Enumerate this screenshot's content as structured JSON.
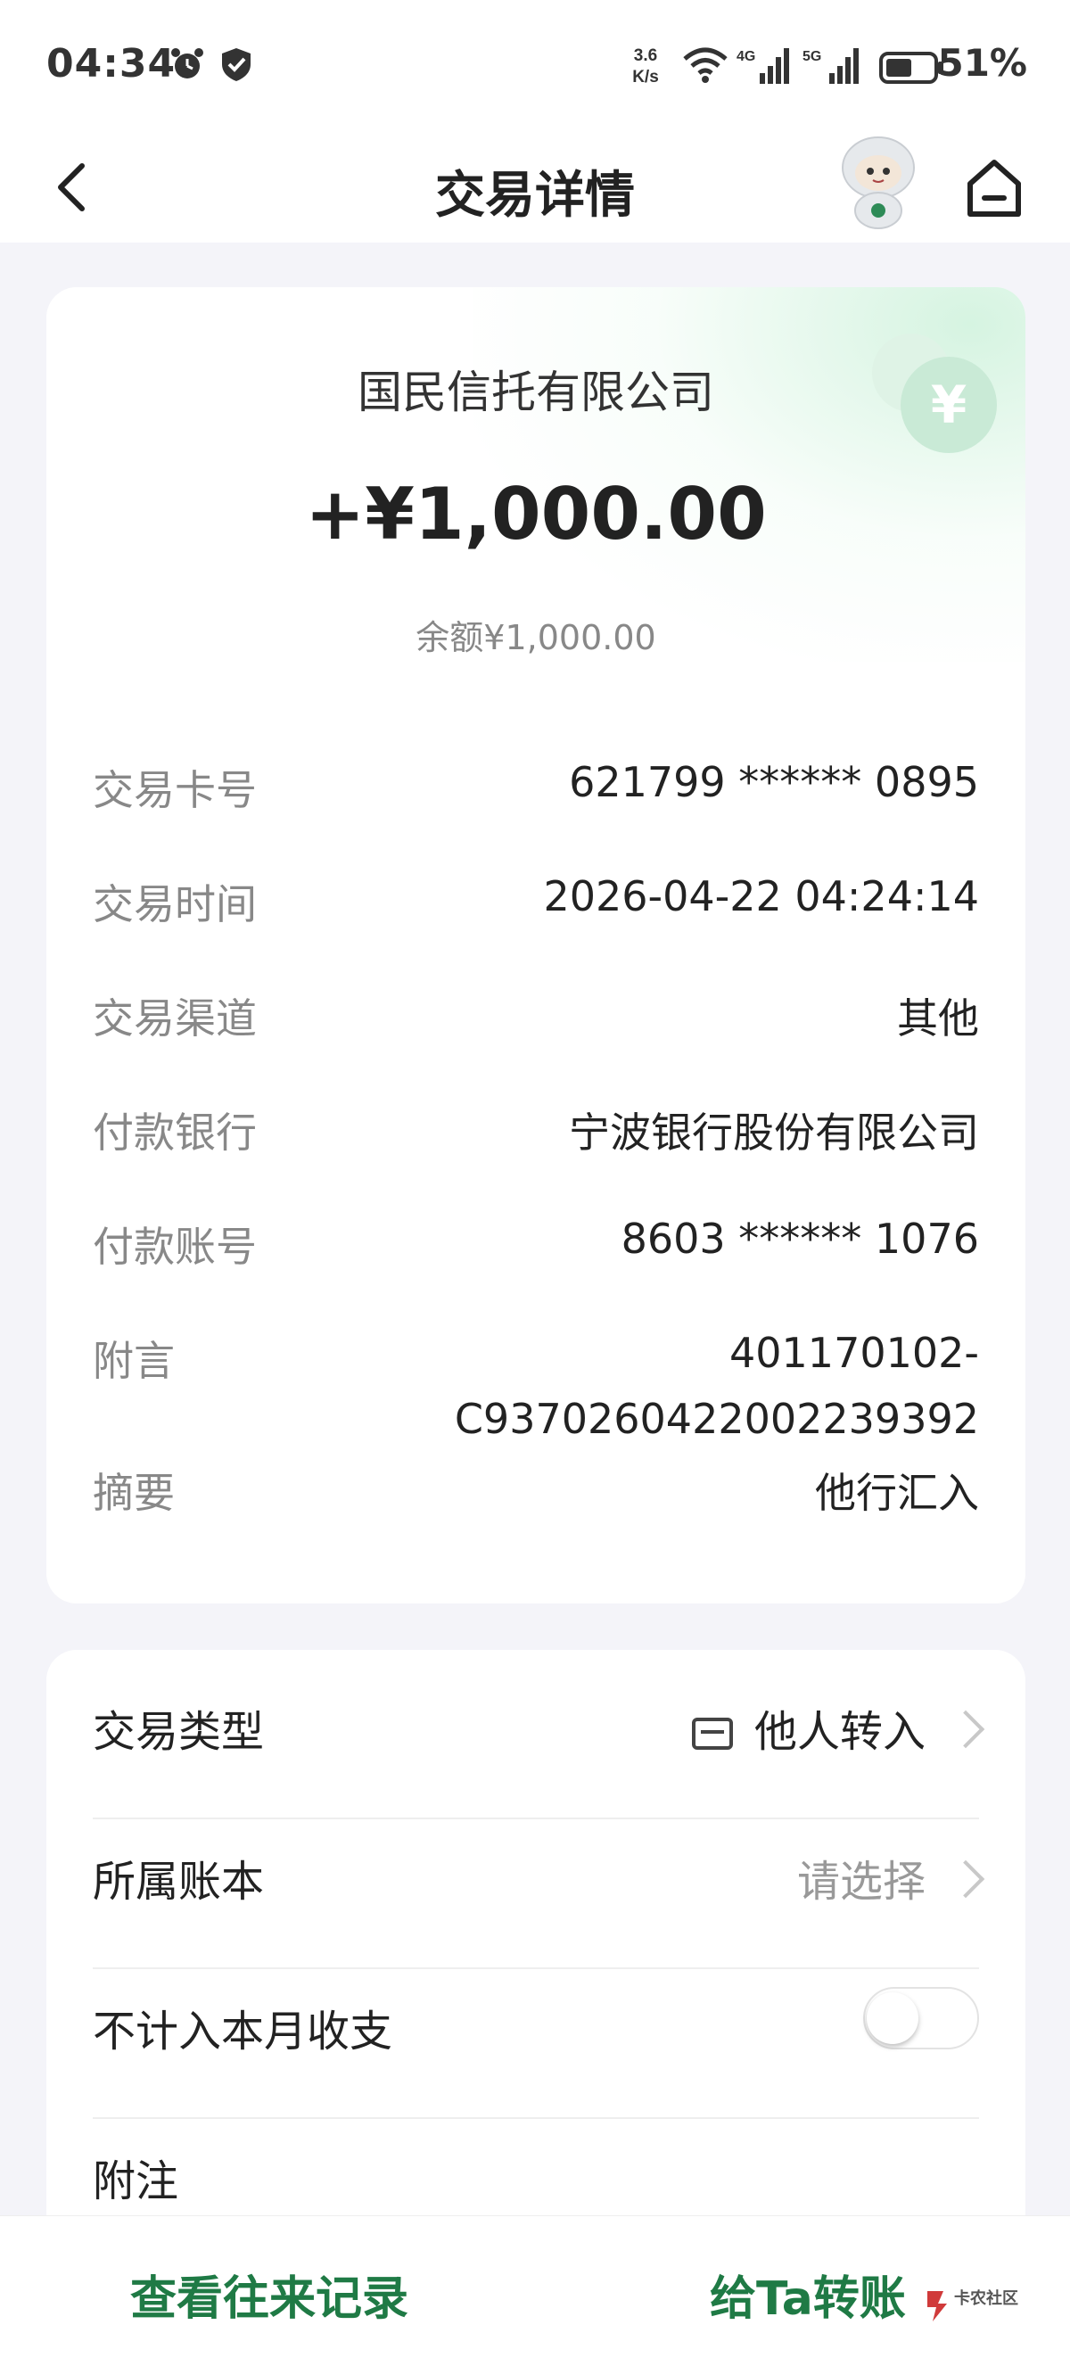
{
  "status_bar": {
    "time": "04:34",
    "net_speed": "3.6 K/s",
    "signal_4g": "4G",
    "signal_5g": "5G",
    "battery": "51%",
    "icons": [
      "alarm-icon",
      "shield-icon",
      "wifi-icon",
      "signal-4g-icon",
      "signal-5g-icon",
      "battery-icon"
    ]
  },
  "nav": {
    "title": "交易详情",
    "icons": [
      "back-icon",
      "mascot-icon",
      "home-icon"
    ]
  },
  "summary": {
    "payer": "国民信托有限公司",
    "amount": "+¥1,000.00",
    "balance": "余额¥1,000.00",
    "coin_symbol": "¥"
  },
  "details": [
    {
      "label": "交易卡号",
      "value": "621799 ****** 0895"
    },
    {
      "label": "交易时间",
      "value": "2026-04-22 04:24:14"
    },
    {
      "label": "交易渠道",
      "value": "其他"
    },
    {
      "label": "付款银行",
      "value": "宁波银行股份有限公司"
    },
    {
      "label": "付款账号",
      "value": "8603 ****** 1076"
    },
    {
      "label": "附言",
      "value": "401170102-",
      "value_line2": "C93702604220022​39392"
    },
    {
      "label": "摘要",
      "value": "他行汇入"
    }
  ],
  "settings": {
    "type_label": "交易类型",
    "type_value": "他人转入",
    "book_label": "所属账本",
    "book_value": "请选择",
    "exclude_label": "不计入本月收支",
    "exclude_on": false,
    "note_label": "附注"
  },
  "bottom": {
    "history": "查看往来记录",
    "transfer": "给Ta转账",
    "watermark": "卡农社区"
  },
  "colors": {
    "accent": "#1f7a45",
    "background": "#f4f4f9",
    "label_gray": "#888888"
  }
}
